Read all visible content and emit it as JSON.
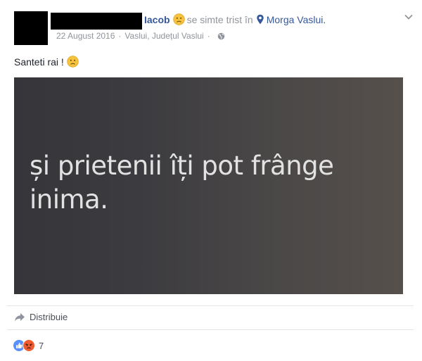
{
  "post": {
    "author_visible": "Iacob",
    "feeling_text": "se simte trist în",
    "location": "Morga Vaslui.",
    "date": "22 August 2016",
    "place_subline": "Vaslui, Județul Vaslui",
    "separator": "·",
    "message": "Santeti rai !",
    "image_caption": "și prietenii îți pot frânge inima."
  },
  "actions": {
    "share_label": "Distribuie"
  },
  "reactions": {
    "count": "7"
  },
  "colors": {
    "link": "#365899",
    "muted": "#90949c",
    "text": "#1d2129",
    "like": "#5890ff",
    "angry": "#f05c2f",
    "emoji_yellow": "#f7c33c"
  }
}
